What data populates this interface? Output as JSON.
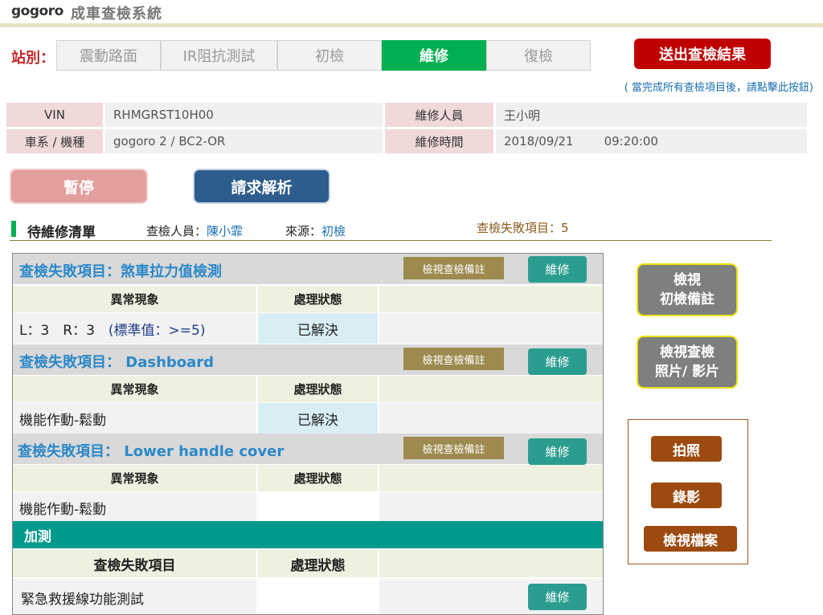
{
  "header": {
    "logo": "gogoro",
    "title": "成車查檢系統"
  },
  "station": {
    "label": "站別：",
    "tabs": [
      {
        "label": "震動路面",
        "active": false
      },
      {
        "label": "IR阻抗測試",
        "active": false
      },
      {
        "label": "初檢",
        "active": false
      },
      {
        "label": "維修",
        "active": true
      },
      {
        "label": "復檢",
        "active": false
      }
    ]
  },
  "submit": {
    "label": "送出查檢結果",
    "hint": "( 當完成所有查檢項目後，請點擊此按鈕)"
  },
  "info": {
    "vin_label": "VIN",
    "vin_value": "RHMGRST10H00",
    "model_label": "車系 / 機種",
    "model_value": "gogoro 2 / BC2-OR",
    "repairer_label": "維修人員",
    "repairer_value": "王小明",
    "time_label": "維修時間",
    "time_value": "2018/09/21        09:20:00"
  },
  "actions": {
    "pause": "暫停",
    "analyze": "請求解析"
  },
  "list": {
    "title": "待維修清單",
    "inspector_label": "查檢人員：",
    "inspector_value": "陳小霏",
    "source_label": "來源：",
    "source_value": "初檢",
    "fail_count": "查檢失敗項目：5"
  },
  "columns": {
    "anomaly": "異常現象",
    "status": "處理狀態"
  },
  "sections": [
    {
      "title": "查檢失敗項目：煞車拉力值檢測",
      "note_btn": "檢視查檢備註",
      "repair_btn": "維修",
      "anomaly_main": "L：3　R：3　",
      "anomaly_std": "(標準值：>=5)",
      "status": "已解決"
    },
    {
      "title": "查檢失敗項目： Dashboard",
      "note_btn": "檢視查檢備註",
      "repair_btn": "維修",
      "anomaly_main": "機能作動-鬆動",
      "anomaly_std": "",
      "status": "已解決"
    },
    {
      "title": "查檢失敗項目： Lower handle cover",
      "note_btn": "檢視查檢備註",
      "repair_btn": "維修",
      "anomaly_main": "機能作動-鬆動",
      "anomaly_std": "",
      "status": ""
    }
  ],
  "addon": {
    "title": "加測",
    "col_item": "查檢失敗項目",
    "col_status": "處理狀態",
    "row_item": "緊急救援線功能測試",
    "row_status": "",
    "repair_btn": "維修"
  },
  "side": {
    "view_notes_line1": "檢視",
    "view_notes_line2": "初檢備註",
    "view_media_line1": "檢視查檢",
    "view_media_line2": "照片/ 影片",
    "photo": "拍照",
    "video": "錄影",
    "view_files": "檢視檔案"
  }
}
